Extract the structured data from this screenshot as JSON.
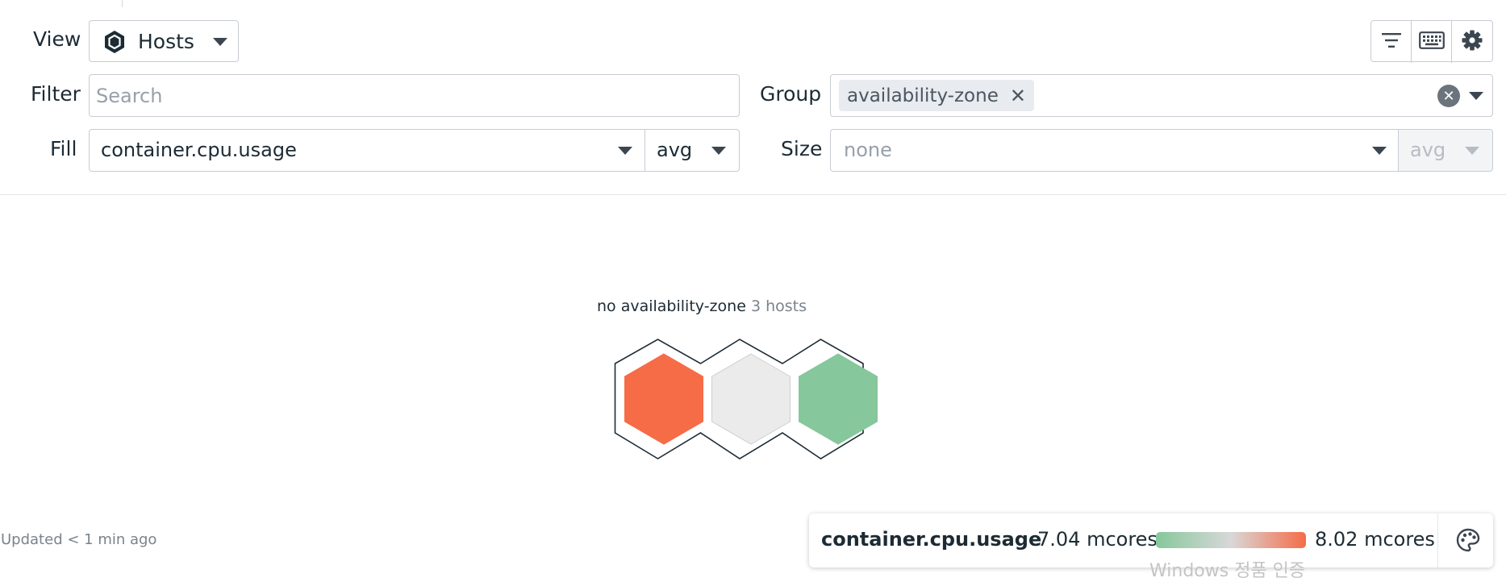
{
  "controls": {
    "view_label": "View",
    "view_value": "Hosts",
    "filter_label": "Filter",
    "filter_placeholder": "Search",
    "filter_value": "",
    "group_label": "Group",
    "group_tags": [
      "availability-zone"
    ],
    "fill_label": "Fill",
    "fill_metric": "container.cpu.usage",
    "fill_aggregation": "avg",
    "size_label": "Size",
    "size_metric": "none",
    "size_aggregation": "avg"
  },
  "toolbar": {
    "icons": [
      "filter-lines-icon",
      "keyboard-icon",
      "gear-icon"
    ]
  },
  "map": {
    "group_title": "no availability-zone",
    "group_count": "3 hosts",
    "hosts": [
      {
        "fill": "#f56c47",
        "level": "high"
      },
      {
        "fill": "#ebebeb",
        "level": "mid"
      },
      {
        "fill": "#86c79b",
        "level": "low"
      }
    ]
  },
  "status": {
    "updated": "Updated < 1 min ago"
  },
  "legend": {
    "metric": "container.cpu.usage",
    "min": "7.04 mcores",
    "max": "8.02 mcores",
    "gradient_start": "#86c79b",
    "gradient_mid": "#d8d8d8",
    "gradient_end": "#f56c47"
  },
  "overlay": {
    "watermark": "Windows 정품 인증"
  }
}
